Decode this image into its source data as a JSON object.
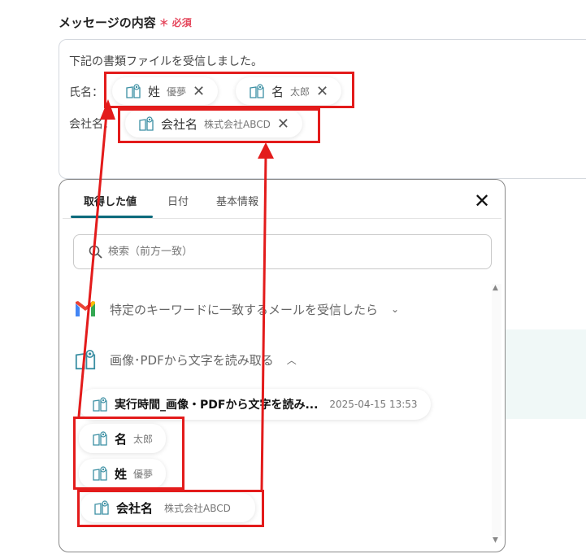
{
  "field": {
    "label": "メッセージの内容",
    "required_mark": "＊",
    "required_text": "必須"
  },
  "message": {
    "line1": "下記の書類ファイルを受信しました。",
    "name_label": "氏名：",
    "company_label": "会社名：",
    "chips": [
      {
        "key": "姓",
        "value": "優夢"
      },
      {
        "key": "名",
        "value": "太郎"
      },
      {
        "key": "会社名",
        "value": "株式会社ABCD"
      }
    ]
  },
  "popup": {
    "tabs": [
      {
        "label": "取得した値",
        "active": true
      },
      {
        "label": "日付"
      },
      {
        "label": "基本情報"
      }
    ],
    "search_placeholder": "検索（前方一致）",
    "sections": [
      {
        "title": "特定のキーワードに一致するメールを受信したら",
        "icon": "gmail-icon",
        "expanded": false
      },
      {
        "title": "画像･PDFから文字を読み取る",
        "icon": "ocr-book-icon",
        "expanded": true
      }
    ],
    "items": [
      {
        "key": "実行時間_画像・PDFから文字を読み...",
        "value": "2025-04-15 13:53"
      },
      {
        "key": "名",
        "value": "太郎"
      },
      {
        "key": "姓",
        "value": "優夢"
      },
      {
        "key": "会社名",
        "value": "株式会社ABCD"
      }
    ]
  },
  "colors": {
    "accent": "#0d6a7c",
    "required": "#e5485d",
    "annotation": "#e31b1b"
  }
}
